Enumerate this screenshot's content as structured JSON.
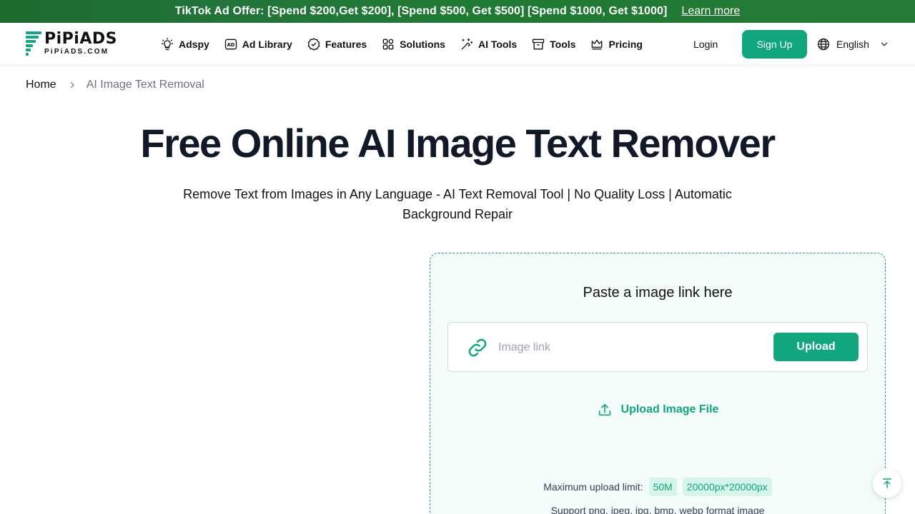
{
  "promo": {
    "text": "TikTok Ad Offer: [Spend $200,Get $200], [Spend $500, Get $500] [Spend $1000, Get $1000]",
    "link": "Learn more"
  },
  "header": {
    "logo_title": "PiPiADS",
    "logo_sub": "PiPiADS.COM",
    "nav": [
      {
        "label": "Adspy",
        "icon": "lightbulb-icon"
      },
      {
        "label": "Ad Library",
        "icon": "ad-badge-icon"
      },
      {
        "label": "Features",
        "icon": "verified-badge-icon"
      },
      {
        "label": "Solutions",
        "icon": "grid-icon"
      },
      {
        "label": "AI Tools",
        "icon": "magic-wand-icon"
      },
      {
        "label": "Tools",
        "icon": "archive-box-icon"
      },
      {
        "label": "Pricing",
        "icon": "crown-icon"
      }
    ],
    "login": "Login",
    "signup": "Sign Up",
    "language": "English"
  },
  "breadcrumb": {
    "home": "Home",
    "current": "AI Image Text Removal"
  },
  "hero": {
    "title": "Free Online AI Image Text Remover",
    "subtitle": "Remove Text from Images in Any Language - AI Text Removal Tool | No Quality Loss | Automatic Background Repair"
  },
  "upload": {
    "title": "Paste a image link here",
    "placeholder": "Image link",
    "upload_button": "Upload",
    "upload_file": "Upload Image File",
    "limit_label": "Maximum upload limit:",
    "limit_size": "50M",
    "limit_dims": "20000px*20000px",
    "formats": "Support png, jpeg, jpg, bmp, webp format image"
  },
  "colors": {
    "brand": "#11a67e",
    "promo_bg": "#1f7a33",
    "card_bg": "#f3fcf9"
  }
}
